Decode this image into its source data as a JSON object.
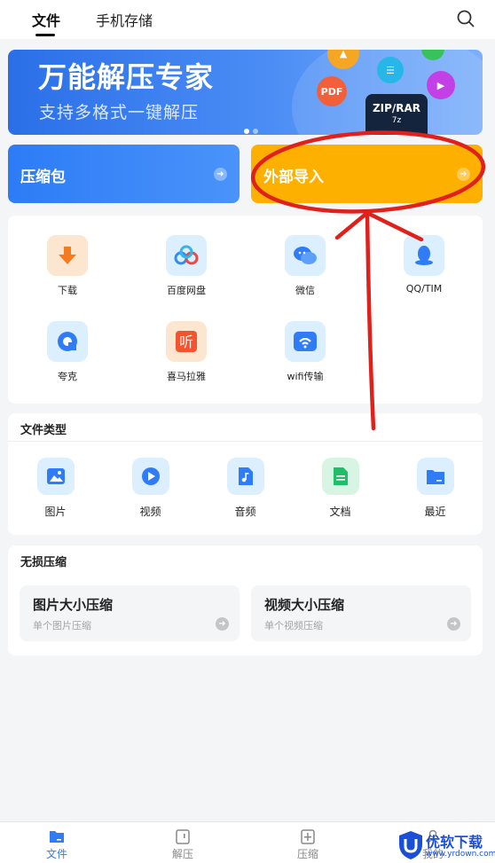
{
  "top_tabs": [
    {
      "label": "文件",
      "active": true
    },
    {
      "label": "手机存储",
      "active": false
    }
  ],
  "banner": {
    "title": "万能解压专家",
    "subtitle": "支持多格式一键解压",
    "badge_pdf": "PDF",
    "zip_label": "ZIP/RAR",
    "zip_sub": "7z"
  },
  "actions": {
    "compress_label": "压缩包",
    "import_label": "外部导入",
    "arrow": "➜"
  },
  "sources": [
    {
      "label": "下载",
      "icon": "download-icon"
    },
    {
      "label": "百度网盘",
      "icon": "baidu-netdisk-icon"
    },
    {
      "label": "微信",
      "icon": "wechat-icon"
    },
    {
      "label": "QQ/TIM",
      "icon": "qq-icon"
    },
    {
      "label": "夸克",
      "icon": "quark-icon"
    },
    {
      "label": "喜马拉雅",
      "icon": "ximalaya-icon"
    },
    {
      "label": "wifi传输",
      "icon": "wifi-icon"
    }
  ],
  "file_types": {
    "title": "文件类型",
    "items": [
      {
        "label": "图片",
        "icon": "image-icon"
      },
      {
        "label": "视频",
        "icon": "video-icon"
      },
      {
        "label": "音频",
        "icon": "audio-icon"
      },
      {
        "label": "文档",
        "icon": "document-icon"
      },
      {
        "label": "最近",
        "icon": "recent-folder-icon"
      }
    ]
  },
  "lossless": {
    "title": "无损压缩",
    "cards": [
      {
        "title": "图片大小压缩",
        "subtitle": "单个图片压缩"
      },
      {
        "title": "视频大小压缩",
        "subtitle": "单个视频压缩"
      }
    ]
  },
  "bottom_nav": [
    {
      "label": "文件",
      "active": true
    },
    {
      "label": "解压",
      "active": false
    },
    {
      "label": "压缩",
      "active": false
    },
    {
      "label": "我的",
      "active": false
    }
  ],
  "watermark": {
    "brand": "优软下载",
    "url": "www.yrdown.com"
  },
  "colors": {
    "accent_blue": "#2f7cf6",
    "import_yellow": "#fdb000",
    "annotation_red": "#e0201b"
  }
}
